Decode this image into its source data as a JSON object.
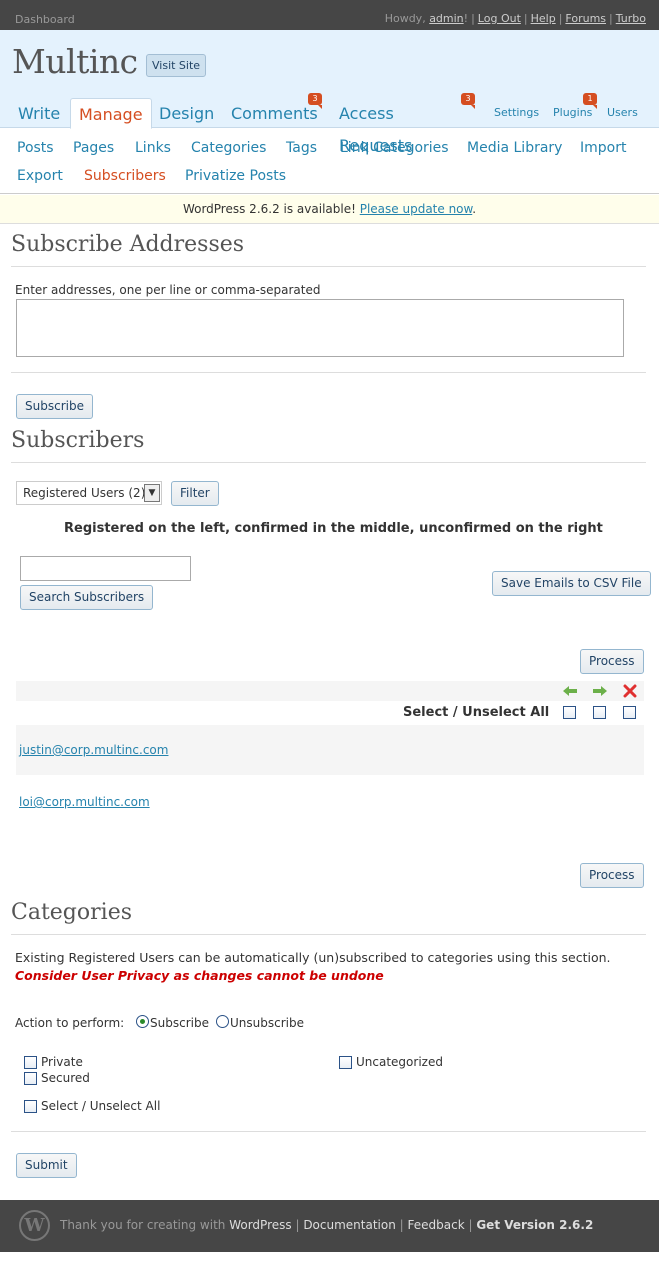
{
  "topbar": {
    "dashboard": "Dashboard",
    "howdy": "Howdy, ",
    "user": "admin",
    "bang": "!",
    "logout": "Log Out",
    "help": "Help",
    "forums": "Forums",
    "turbo": "Turbo"
  },
  "header": {
    "blog_name": "Multinc",
    "visit_site": "Visit Site"
  },
  "mainnav": {
    "write": "Write",
    "manage": "Manage",
    "design": "Design",
    "comments": "Comments",
    "comments_count": "3",
    "access": "Access Requests",
    "access_count": "3",
    "settings": "Settings",
    "plugins": "Plugins",
    "plugins_count": "1",
    "users": "Users"
  },
  "submenu": {
    "items": [
      "Posts",
      "Pages",
      "Links",
      "Categories",
      "Tags",
      "Link Categories",
      "Media Library",
      "Import",
      "Export",
      "Subscribers",
      "Privatize Posts"
    ],
    "current": "Subscribers"
  },
  "notice": {
    "text": "WordPress 2.6.2 is available! ",
    "link": "Please update now",
    "end": "."
  },
  "subscribe": {
    "title": "Subscribe Addresses",
    "instructions": "Enter addresses, one per line or comma-separated",
    "textarea_value": "",
    "button": "Subscribe"
  },
  "subscribers": {
    "title": "Subscribers",
    "filter_selected": "Registered Users (2)",
    "filter_button": "Filter",
    "explain": "Registered on the left, confirmed in the middle, unconfirmed on the right",
    "search_value": "",
    "search_button": "Search Subscribers",
    "csv_button": "Save Emails to CSV File",
    "process_button": "Process",
    "select_all": "Select / Unselect All",
    "emails": [
      "justin@corp.multinc.com",
      "loi@corp.multinc.com"
    ]
  },
  "categories": {
    "title": "Categories",
    "desc": "Existing Registered Users can be automatically (un)subscribed to categories using this section.",
    "warning": "Consider User Privacy as changes cannot be undone",
    "action_label": "Action to perform: ",
    "subscribe": "Subscribe",
    "unsubscribe": "Unsubscribe",
    "items": [
      "Private",
      "Secured",
      "Uncategorized"
    ],
    "select_all": "Select / Unselect All",
    "submit": "Submit"
  },
  "footer": {
    "thanks": "Thank you for creating with ",
    "wordpress": "WordPress",
    "documentation": "Documentation",
    "feedback": "Feedback",
    "get_version": "Get Version 2.6.2",
    "sep": " | "
  },
  "colors": {
    "accent": "#d54e21",
    "link": "#2583ad",
    "header_bg": "#e4f2fd",
    "bar_bg": "#464646",
    "warning": "#cc0000"
  },
  "icons": {
    "add": "arrow-left-icon",
    "confirm": "arrow-right-icon",
    "delete": "x-icon"
  }
}
